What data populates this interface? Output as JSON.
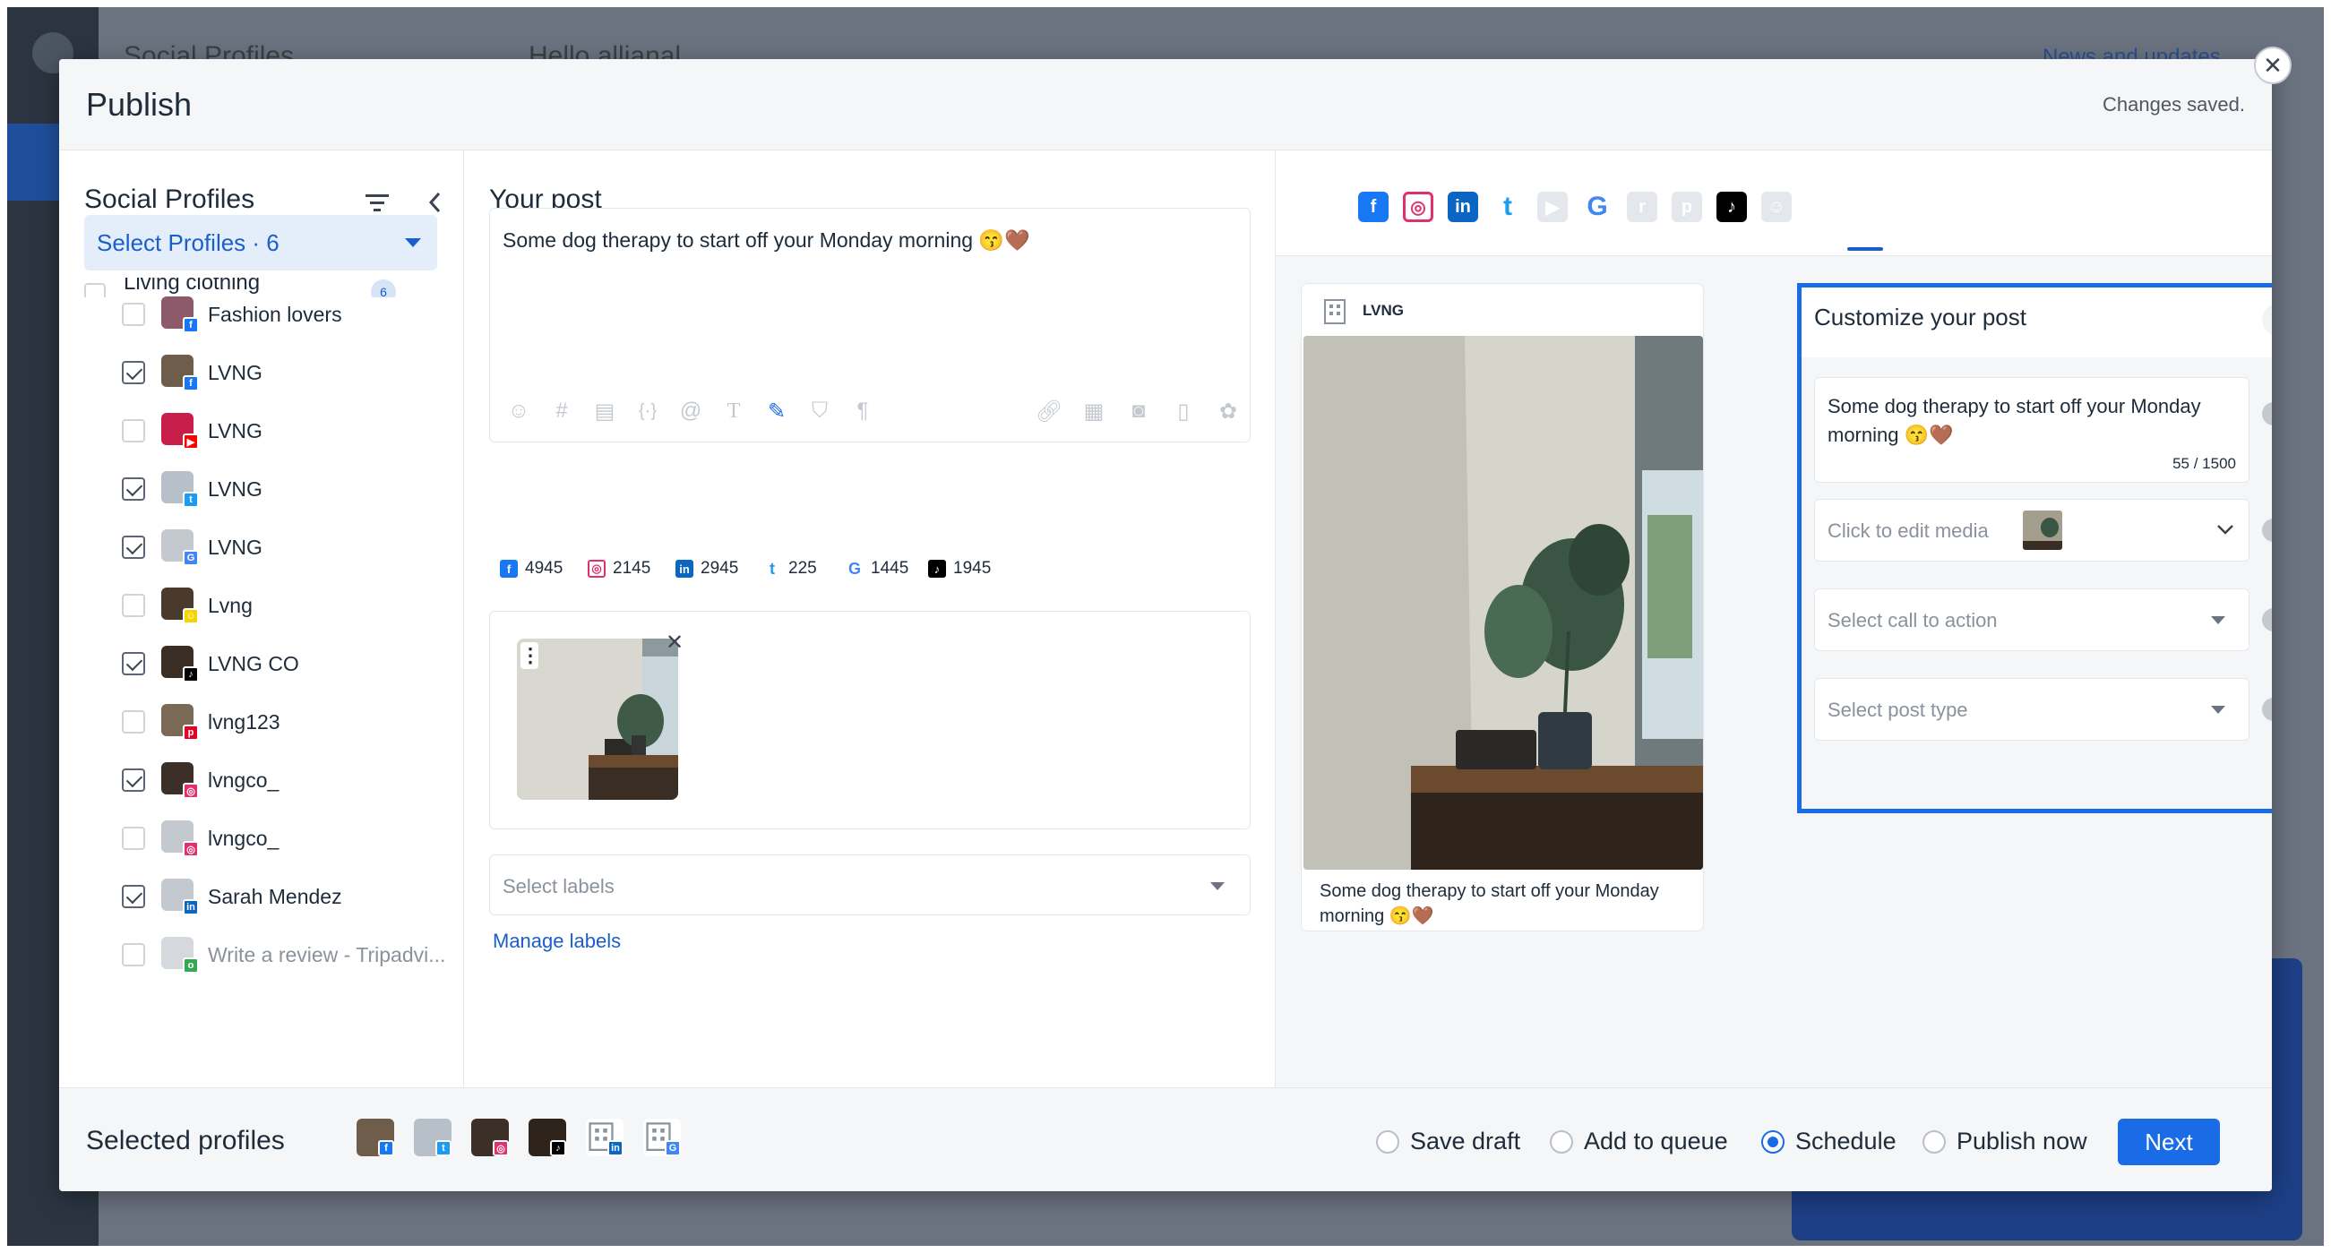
{
  "background": {
    "header_left": "Social Profiles",
    "header_greeting": "Hello allianal",
    "header_right": "News and updates"
  },
  "modal": {
    "title": "Publish",
    "status": "Changes saved.",
    "close_icon": "close-icon"
  },
  "profiles_panel": {
    "title": "Social Profiles",
    "select_label": "Select Profiles · 6",
    "group_label": "Living clothing",
    "group_count": "6",
    "items": [
      {
        "name": "Fashion lovers",
        "network": "facebook",
        "checked": false
      },
      {
        "name": "LVNG",
        "network": "facebook",
        "checked": true
      },
      {
        "name": "LVNG",
        "network": "youtube",
        "checked": false
      },
      {
        "name": "LVNG",
        "network": "twitter",
        "checked": true
      },
      {
        "name": "LVNG",
        "network": "google",
        "checked": true
      },
      {
        "name": "Lvng",
        "network": "snapchat",
        "checked": false
      },
      {
        "name": "LVNG CO",
        "network": "tiktok",
        "checked": true
      },
      {
        "name": "lvng123",
        "network": "pinterest",
        "checked": false
      },
      {
        "name": "lvngco_",
        "network": "instagram",
        "checked": true
      },
      {
        "name": "lvngco_",
        "network": "instagram",
        "checked": false
      },
      {
        "name": "Sarah Mendez",
        "network": "linkedin",
        "checked": true
      },
      {
        "name": "Write a review - Tripadvi...",
        "network": "tripadvisor",
        "checked": false
      }
    ]
  },
  "post": {
    "title": "Your post",
    "text": "Some dog therapy to start off your Monday morning 😙🤎",
    "char_counts": [
      {
        "network": "facebook",
        "value": "4945"
      },
      {
        "network": "instagram",
        "value": "2145"
      },
      {
        "network": "linkedin",
        "value": "2945"
      },
      {
        "network": "twitter",
        "value": "225"
      },
      {
        "network": "google",
        "value": "1445"
      },
      {
        "network": "tiktok",
        "value": "1945"
      }
    ],
    "labels_placeholder": "Select labels",
    "manage_labels": "Manage labels"
  },
  "preview": {
    "networks": [
      "facebook",
      "instagram",
      "linkedin",
      "twitter",
      "youtube",
      "google",
      "reddit",
      "pinterest",
      "tiktok",
      "snapchat"
    ],
    "active_network": "google",
    "profile_name": "LVNG",
    "caption": "Some dog therapy to start off your Monday morning 😙🤎"
  },
  "customize": {
    "title": "Customize your post",
    "text": "Some dog therapy to start off your Monday morning 😙🤎",
    "char_counter": "55 / 1500",
    "media_placeholder": "Click to edit media",
    "cta_placeholder": "Select call to action",
    "post_type_placeholder": "Select post type"
  },
  "footer": {
    "selected_title": "Selected profiles",
    "options": [
      {
        "label": "Save draft",
        "selected": false
      },
      {
        "label": "Add to queue",
        "selected": false
      },
      {
        "label": "Schedule",
        "selected": true
      },
      {
        "label": "Publish now",
        "selected": false
      }
    ],
    "next_label": "Next"
  },
  "colors": {
    "accent": "#1a6ce6",
    "link": "#1a5fc9",
    "facebook": "#1877f2",
    "instagram": "#e1306c",
    "linkedin": "#0a66c2",
    "twitter": "#1d9bf0",
    "google": "#4285f4",
    "tiktok": "#000000"
  }
}
